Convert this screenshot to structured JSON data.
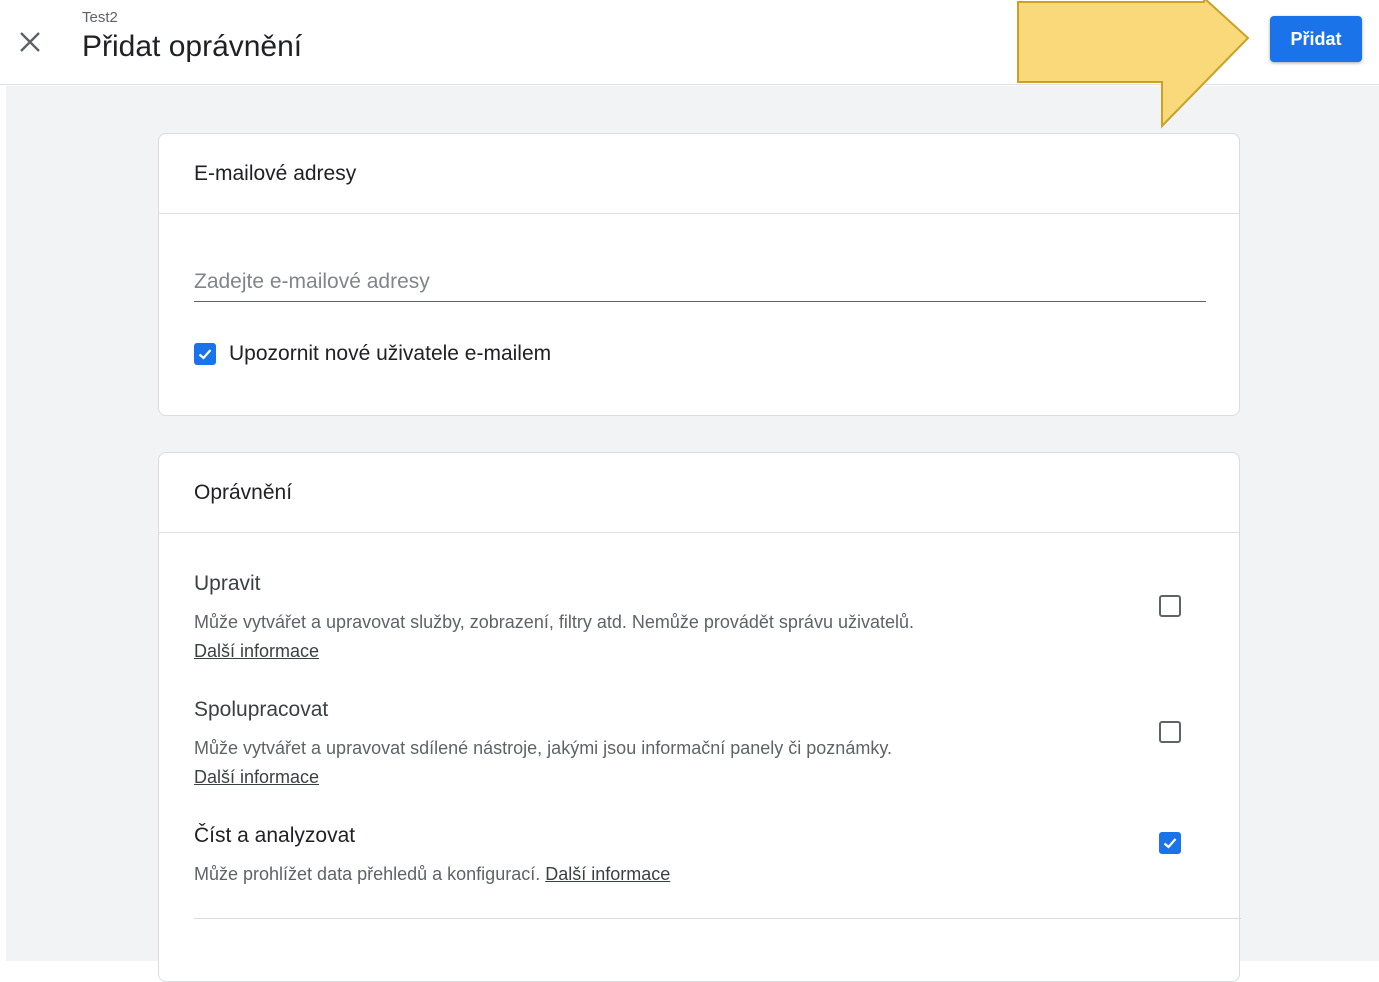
{
  "header": {
    "subtitle": "Test2",
    "title": "Přidat oprávnění",
    "add_button": "Přidat",
    "close_icon": "close-icon"
  },
  "email_card": {
    "title": "E-mailové adresy",
    "input_placeholder": "Zadejte e-mailové adresy",
    "input_value": "",
    "notify_label": "Upozornit nové uživatele e-mailem",
    "notify_checked": true
  },
  "permissions_card": {
    "title": "Oprávnění",
    "items": [
      {
        "title": "Upravit",
        "description": "Může vytvářet a upravovat služby, zobrazení, filtry atd. Nemůže provádět správu uživatelů. ",
        "link": "Další informace",
        "checked": false
      },
      {
        "title": "Spolupracovat",
        "description": "Může vytvářet a upravovat sdílené nástroje, jakými jsou informační panely či poznámky. ",
        "link": "Další informace",
        "checked": false
      },
      {
        "title": "Číst a analyzovat",
        "description": "Může prohlížet data přehledů a konfigurací. ",
        "link": "Další informace",
        "checked": true
      }
    ]
  },
  "colors": {
    "accent": "#1a73e8",
    "annotation_arrow": "#f9d97a",
    "background": "#f1f3f4"
  }
}
